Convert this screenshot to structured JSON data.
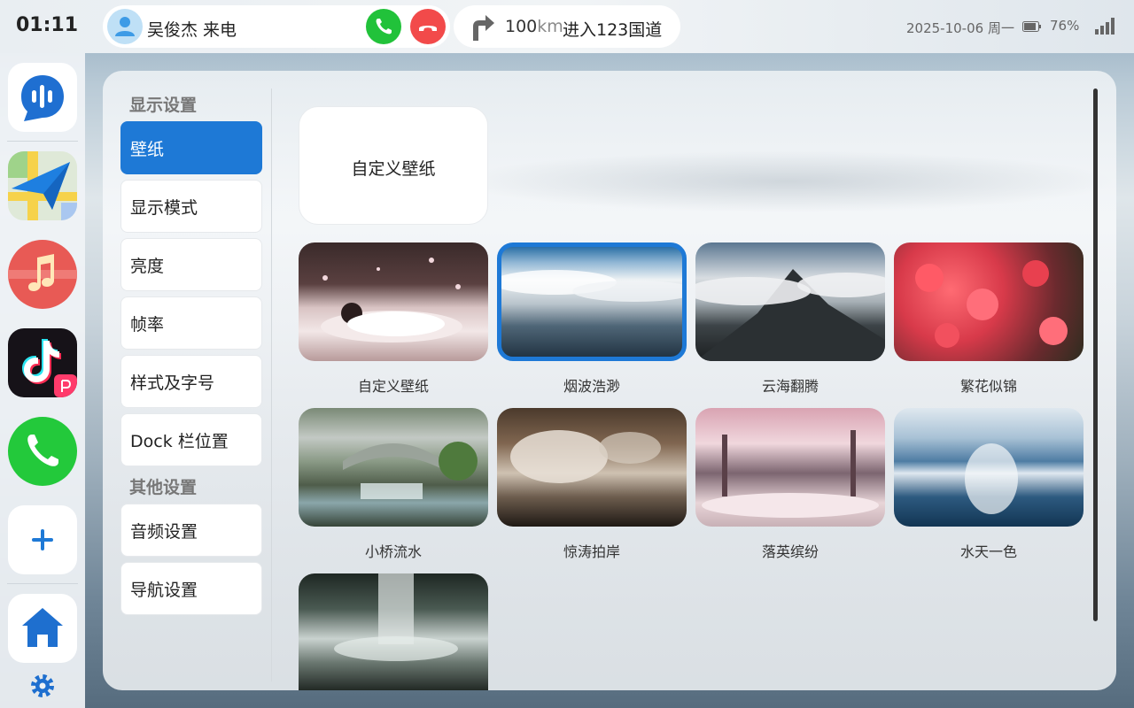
{
  "status_bar": {
    "time": "01:11",
    "call": {
      "caller": "吴俊杰 来电"
    },
    "navigation": {
      "distance": "100",
      "unit": "km",
      "instruction": "进入123国道"
    },
    "date": "2025-10-06 周一",
    "battery": "76%"
  },
  "dock": {
    "apps": [
      {
        "name": "voice-assistant"
      },
      {
        "name": "maps"
      },
      {
        "name": "music"
      },
      {
        "name": "tiktok"
      },
      {
        "name": "phone"
      }
    ]
  },
  "menu": {
    "sections": [
      {
        "title": "显示设置",
        "items": [
          "壁纸",
          "显示模式",
          "亮度",
          "帧率",
          "样式及字号",
          "Dock 栏位置"
        ]
      },
      {
        "title": "其他设置",
        "items": [
          "音频设置",
          "导航设置"
        ]
      }
    ],
    "active_item": "壁纸"
  },
  "wallpaper": {
    "custom_card_label": "自定义壁纸",
    "selected": "烟波浩渺",
    "items": [
      {
        "label": "自定义壁纸"
      },
      {
        "label": "烟波浩渺"
      },
      {
        "label": "云海翻腾"
      },
      {
        "label": "繁花似锦"
      },
      {
        "label": "小桥流水"
      },
      {
        "label": "惊涛拍岸"
      },
      {
        "label": "落英缤纷"
      },
      {
        "label": "水天一色"
      },
      {
        "label": ""
      }
    ]
  },
  "colors": {
    "accent": "#1e79d6",
    "accept_call": "#21c23a",
    "reject_call": "#f24a4a"
  }
}
